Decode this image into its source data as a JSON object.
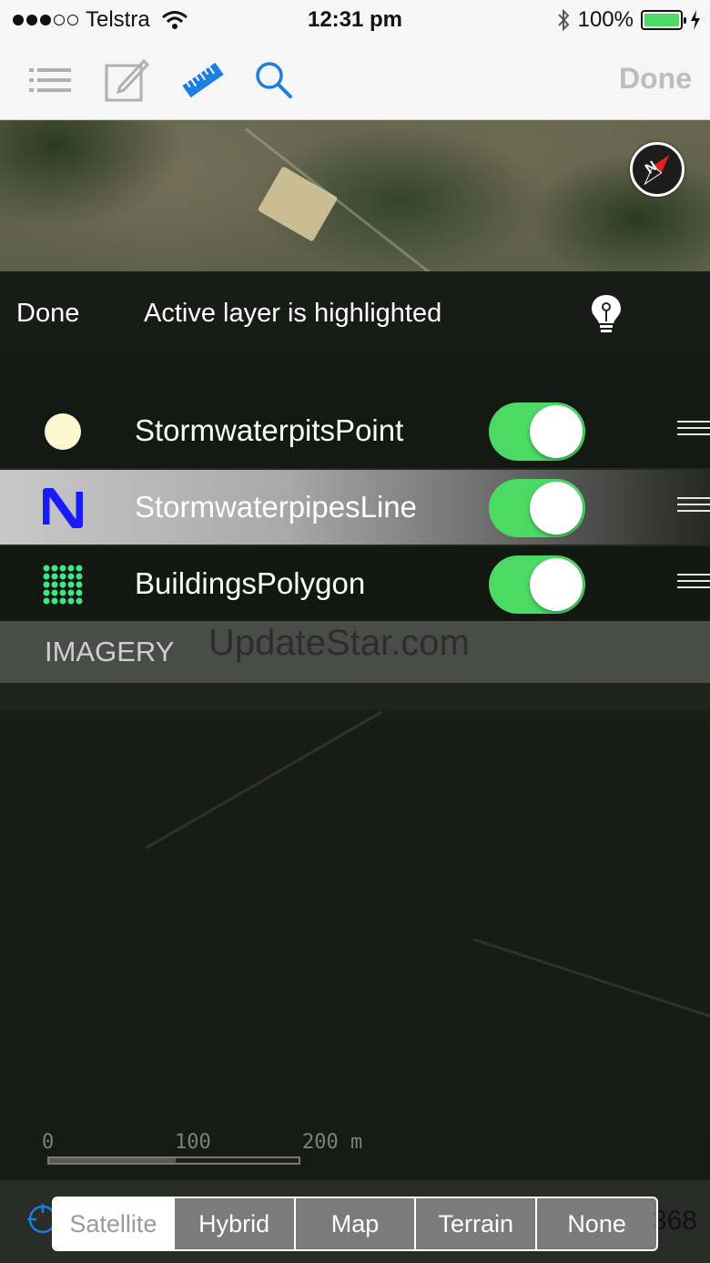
{
  "status_bar": {
    "carrier": "Telstra",
    "time": "12:31 pm",
    "battery": "100%"
  },
  "toolbar": {
    "done_label": "Done",
    "icons": [
      "list-icon",
      "edit-icon",
      "ruler-icon",
      "search-icon"
    ],
    "active_icon": "ruler-icon"
  },
  "layers_panel": {
    "done_label": "Done",
    "hint": "Active layer is highlighted",
    "layers": [
      {
        "name": "StormwaterpitsPoint",
        "symbol": "point-circle",
        "visible": true,
        "active": false
      },
      {
        "name": "StormwaterpipesLine",
        "symbol": "line",
        "visible": true,
        "active": true
      },
      {
        "name": "BuildingsPolygon",
        "symbol": "polygon-grid",
        "visible": true,
        "active": false
      }
    ],
    "imagery_header": "IMAGERY",
    "watermark": "UpdateStar.com"
  },
  "scale_bar": {
    "ticks": [
      "0",
      "100",
      "200 m"
    ]
  },
  "basemap_selector": {
    "options": [
      "Satellite",
      "Hybrid",
      "Map",
      "Terrain",
      "None"
    ],
    "selected": "Satellite"
  },
  "bottom_bar": {
    "count_text": "368"
  },
  "colors": {
    "accent": "#1a7fe0",
    "toggle_on": "#4cd964",
    "point_symbol": "#fdf8d0",
    "line_symbol": "#1a1aff",
    "polygon_symbol": "#3ce882"
  }
}
